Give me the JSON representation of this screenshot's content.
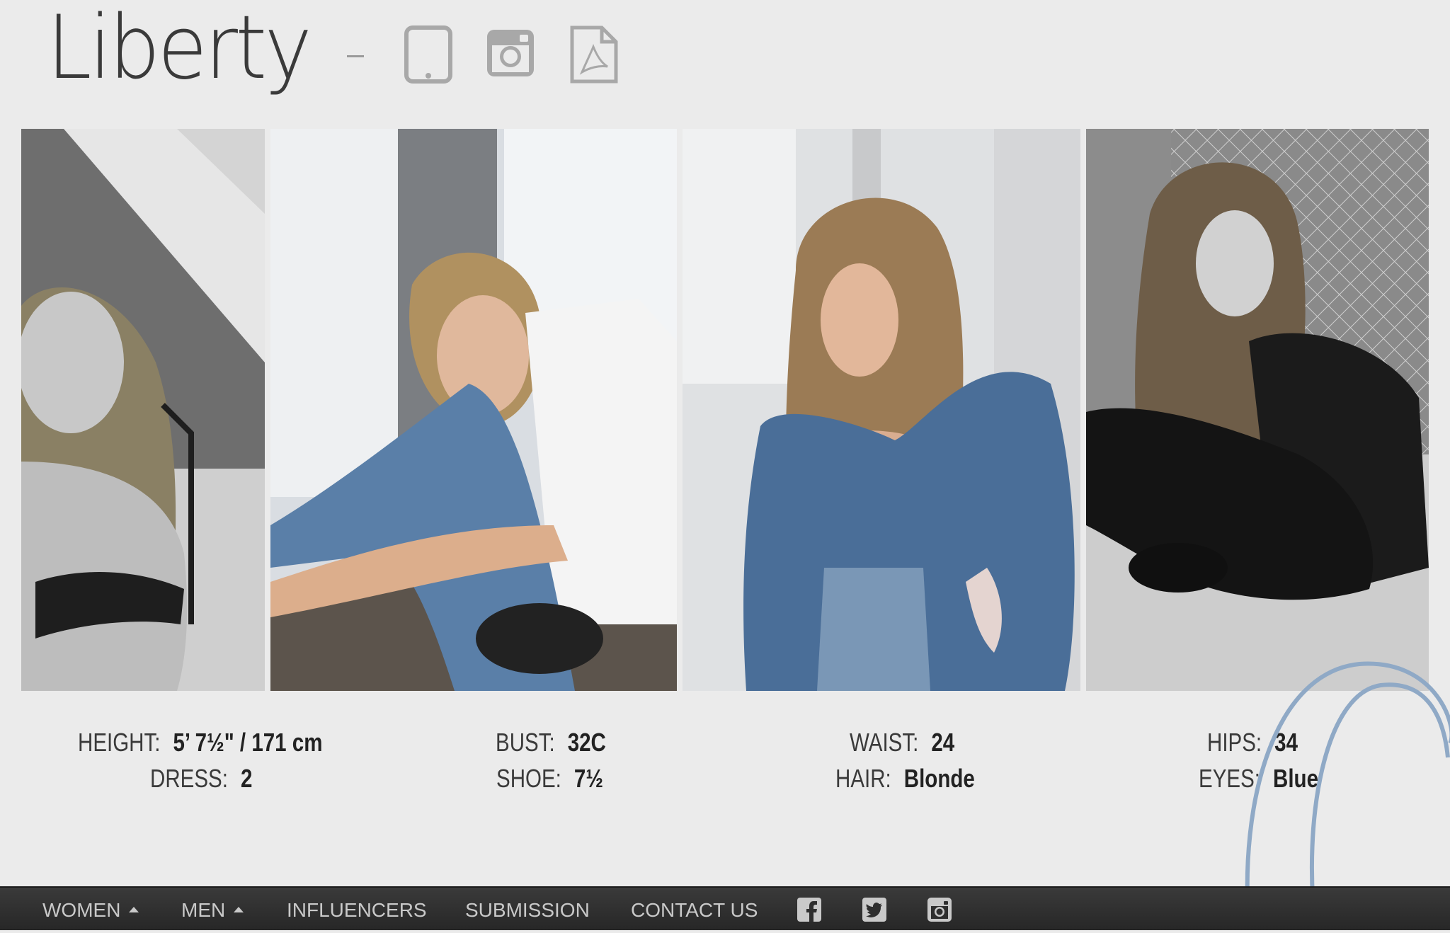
{
  "header": {
    "model_name": "Liberty",
    "separator": "–",
    "icons": [
      "tablet-icon",
      "instagram-icon",
      "pdf-icon"
    ]
  },
  "photos": [
    {
      "name": "photo-1"
    },
    {
      "name": "photo-2"
    },
    {
      "name": "photo-3"
    },
    {
      "name": "photo-4"
    }
  ],
  "stats": {
    "height": {
      "label": "HEIGHT:",
      "value": "5’ 7½\" / 171 cm"
    },
    "dress": {
      "label": "DRESS:",
      "value": "2"
    },
    "bust": {
      "label": "BUST:",
      "value": "32C"
    },
    "shoe": {
      "label": "SHOE:",
      "value": "7½"
    },
    "waist": {
      "label": "WAIST:",
      "value": "24"
    },
    "hair": {
      "label": "HAIR:",
      "value": "Blonde"
    },
    "hips": {
      "label": "HIPS:",
      "value": "34"
    },
    "eyes": {
      "label": "EYES:",
      "value": "Blue"
    }
  },
  "nav": {
    "women": "WOMEN",
    "men": "MEN",
    "influencers": "INFLUENCERS",
    "submission": "SUBMISSION",
    "contact": "CONTACT US",
    "social": [
      "facebook-icon",
      "twitter-icon",
      "instagram-icon"
    ]
  },
  "colors": {
    "background": "#ebebeb",
    "nav_bg": "#2e2e2e",
    "nav_text": "#c9c9c9",
    "icon_gray": "#a8a8a8"
  }
}
